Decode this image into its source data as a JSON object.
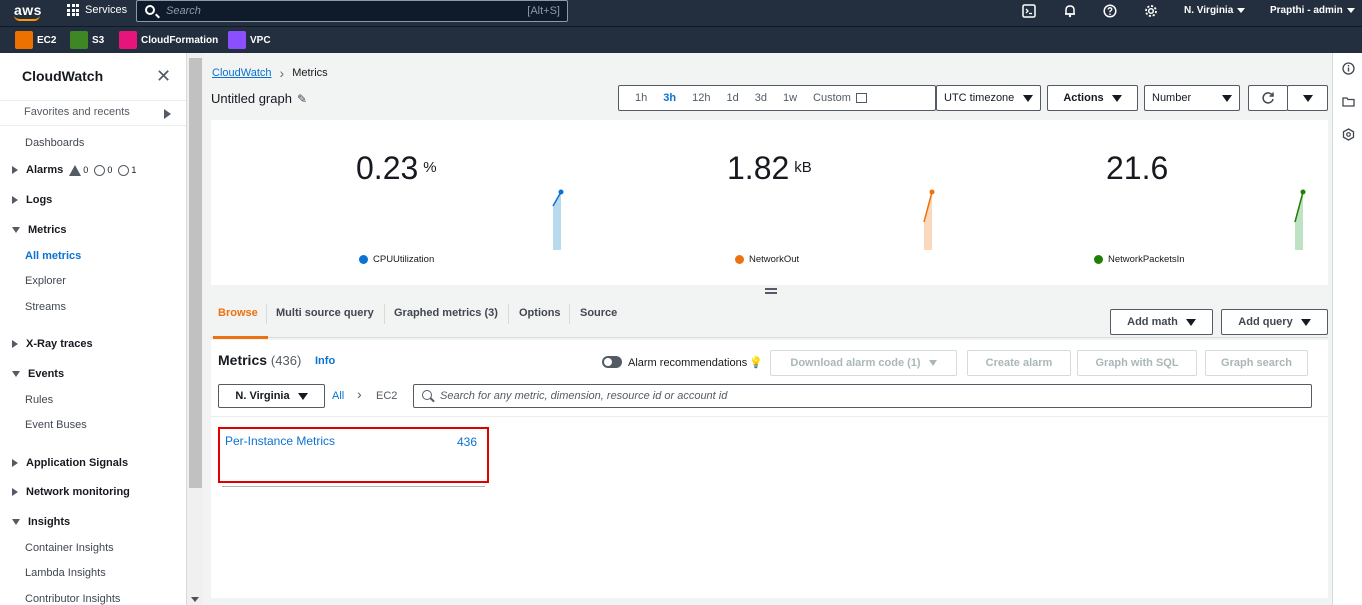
{
  "topnav": {
    "logo": "aws",
    "services_label": "Services",
    "search_placeholder": "Search",
    "search_shortcut": "[Alt+S]",
    "region": "N. Virginia",
    "user": "Prapthi - admin",
    "favorites": [
      {
        "label": "EC2",
        "color": "#ed7100"
      },
      {
        "label": "S3",
        "color": "#3f8624"
      },
      {
        "label": "CloudFormation",
        "color": "#e7157b"
      },
      {
        "label": "VPC",
        "color": "#8c4fff"
      }
    ]
  },
  "sidebar": {
    "title": "CloudWatch",
    "favorites_label": "Favorites and recents",
    "dashboards": "Dashboards",
    "alarms": {
      "label": "Alarms",
      "in_alarm": "0",
      "ok": "0",
      "insufficient": "1"
    },
    "logs": "Logs",
    "metrics": "Metrics",
    "metrics_items": [
      "All metrics",
      "Explorer",
      "Streams"
    ],
    "xray": "X-Ray traces",
    "events": "Events",
    "events_items": [
      "Rules",
      "Event Buses"
    ],
    "app_signals": "Application Signals",
    "network_monitoring": "Network monitoring",
    "insights": "Insights",
    "insights_items": [
      "Container Insights",
      "Lambda Insights",
      "Contributor Insights"
    ]
  },
  "breadcrumb": {
    "root": "CloudWatch",
    "current": "Metrics"
  },
  "graph": {
    "title": "Untitled graph",
    "time_ranges": [
      "1h",
      "3h",
      "12h",
      "1d",
      "3d",
      "1w",
      "Custom"
    ],
    "active_range": "3h",
    "timezone": "UTC timezone",
    "actions": "Actions",
    "view_type": "Number"
  },
  "widgets": [
    {
      "value": "0.23",
      "unit": "%",
      "label": "CPUUtilization",
      "color": "#0972d3",
      "fill": "#b8d9ee"
    },
    {
      "value": "1.82",
      "unit": "kB",
      "label": "NetworkOut",
      "color": "#ec7211",
      "fill": "#fbd8bc"
    },
    {
      "value": "21.6",
      "unit": "",
      "label": "NetworkPacketsIn",
      "color": "#1d8102",
      "fill": "#bde3c3"
    }
  ],
  "tabs": [
    "Browse",
    "Multi source query",
    "Graphed metrics (3)",
    "Options",
    "Source"
  ],
  "active_tab": "Browse",
  "tab_buttons": {
    "add_math": "Add math",
    "add_query": "Add query"
  },
  "metrics_panel": {
    "title": "Metrics",
    "count": "(436)",
    "info": "Info",
    "alarm_recommendations": "Alarm recommendations",
    "download_alarm_code": "Download alarm code (1)",
    "create_alarm": "Create alarm",
    "graph_with_sql": "Graph with SQL",
    "graph_search": "Graph search",
    "region_filter": "N. Virginia",
    "crumb_all": "All",
    "crumb_ec2": "EC2",
    "search_placeholder": "Search for any metric, dimension, resource id or account id",
    "card": {
      "name": "Per-Instance Metrics",
      "count": "436"
    }
  }
}
